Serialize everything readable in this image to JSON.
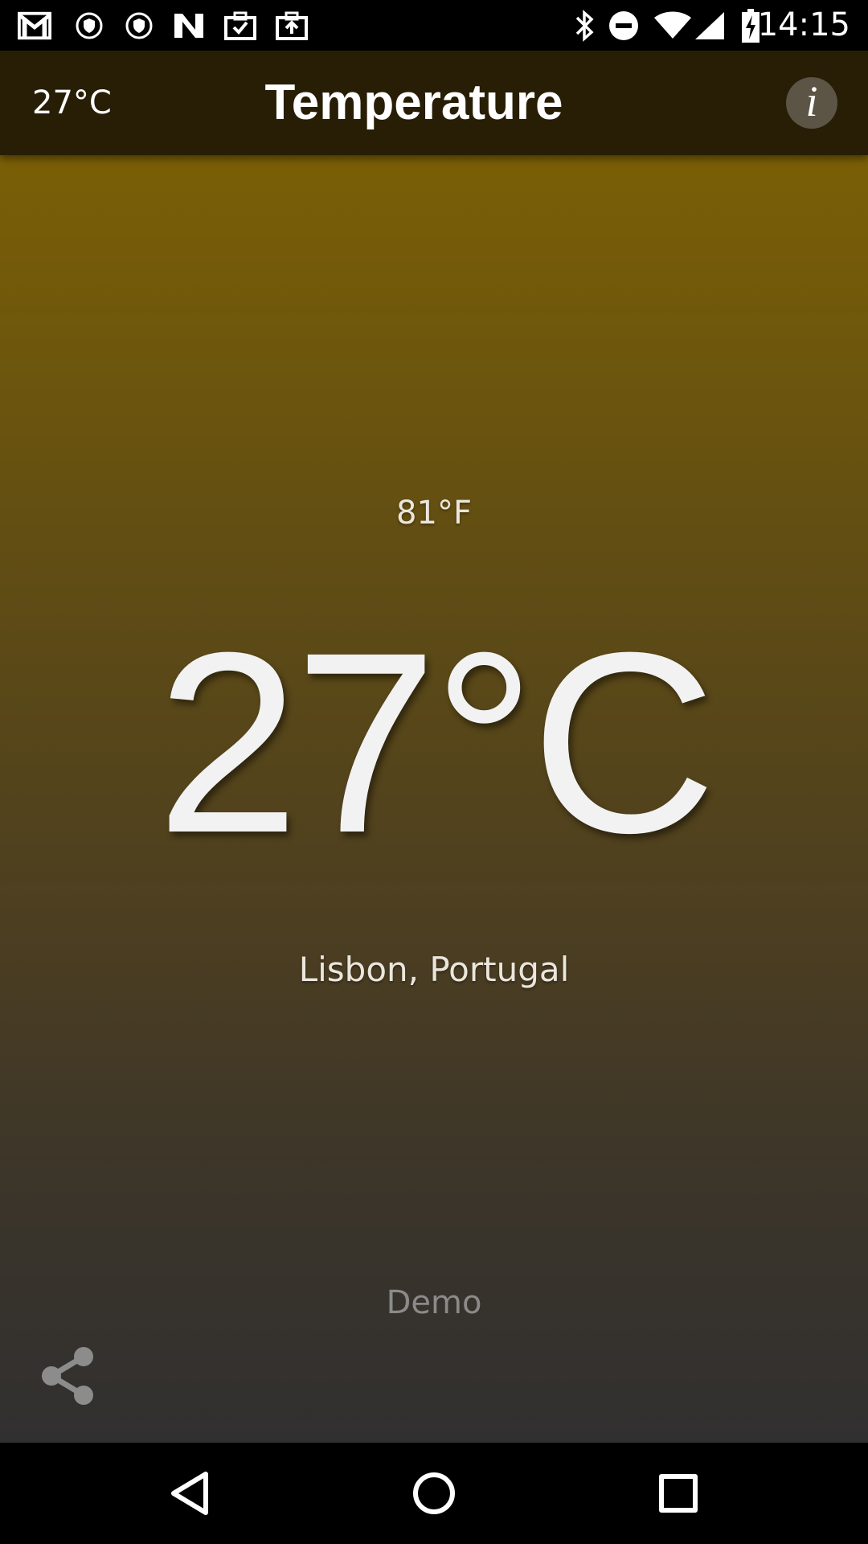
{
  "status_bar": {
    "time": "14:15",
    "left_icons": [
      "gmail-icon",
      "shield-icon",
      "shield-icon",
      "n-app-icon",
      "briefcase-check-icon",
      "briefcase-upload-icon"
    ],
    "right_icons": [
      "bluetooth-icon",
      "do-not-disturb-icon",
      "wifi-icon",
      "cell-signal-icon",
      "battery-charging-icon"
    ]
  },
  "app_bar": {
    "current_temp": "27°C",
    "title": "Temperature",
    "info_label": "i"
  },
  "main": {
    "fahrenheit": "81°F",
    "celsius": "27°C",
    "location": "Lisbon, Portugal",
    "demo_label": "Demo"
  },
  "colors": {
    "app_bar": "#281e06",
    "gradient_top": "#7a5f06",
    "gradient_bottom": "#313030",
    "text_primary": "#f2f2f2",
    "text_muted": "#8a8a8a"
  },
  "nav_bar": {
    "buttons": [
      "back-icon",
      "home-icon",
      "recents-icon"
    ]
  }
}
